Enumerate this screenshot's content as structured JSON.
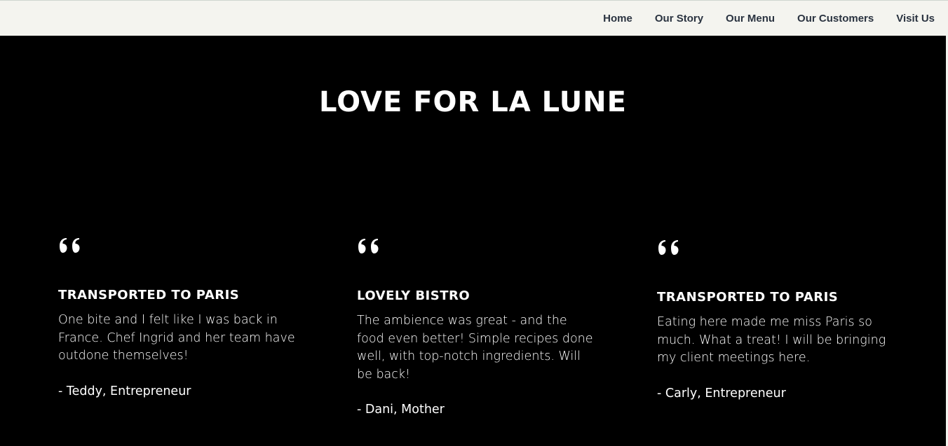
{
  "nav": {
    "items": [
      {
        "label": "Home"
      },
      {
        "label": "Our Story"
      },
      {
        "label": "Our Menu"
      },
      {
        "label": "Our Customers"
      },
      {
        "label": "Visit Us"
      }
    ]
  },
  "section": {
    "title": "LOVE FOR LA LUNE"
  },
  "testimonials": [
    {
      "icon": "quote-icon",
      "heading": "TRANSPORTED TO PARIS",
      "body": "One bite and I felt like I was back in France. Chef Ingrid and her team have outdone themselves!",
      "author": "- Teddy, Entrepreneur"
    },
    {
      "icon": "quote-icon",
      "heading": "LOVELY BISTRO",
      "body": "The ambience was great - and the food even better! Simple recipes done well, with top-notch ingredients. Will be back!",
      "author": "- Dani, Mother"
    },
    {
      "icon": "quote-icon",
      "heading": "TRANSPORTED TO PARIS",
      "body": "Eating here made me miss Paris so much. What a treat! I will be bringing my client meetings here.",
      "author": "- Carly, Entrepreneur"
    }
  ],
  "colors": {
    "nav_bg": "#f4f4ef",
    "nav_text": "#2a3340",
    "section_bg": "#000000",
    "text": "#ffffff"
  }
}
